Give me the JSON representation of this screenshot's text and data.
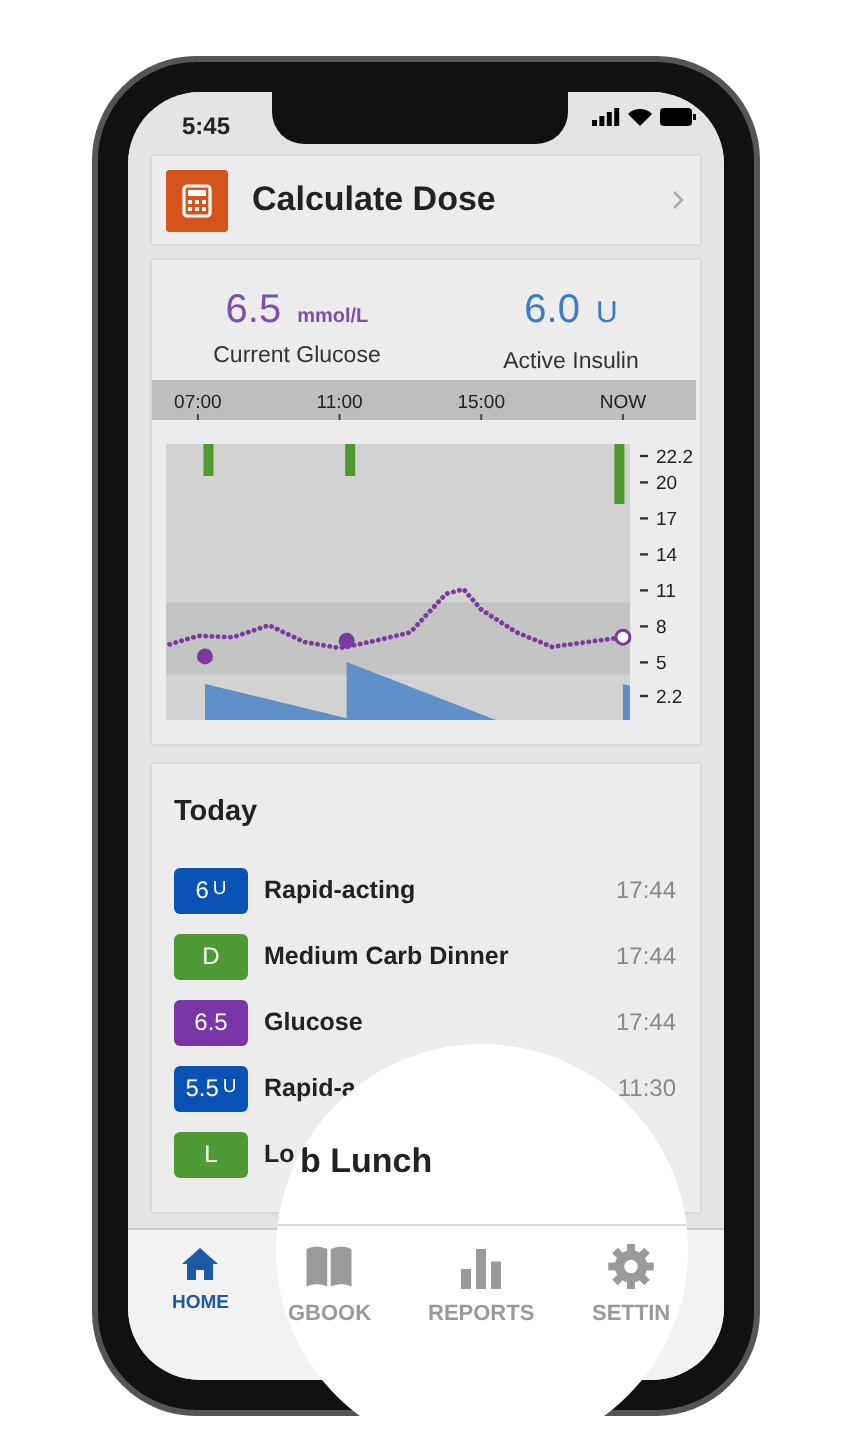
{
  "status_bar": {
    "time": "5:45"
  },
  "dose_card": {
    "title": "Calculate Dose"
  },
  "stats": [
    {
      "value": "6.5",
      "unit": "mmol/L",
      "label": "Current Glucose",
      "color": "#7d4fab"
    },
    {
      "value": "6.0",
      "unit": "U",
      "label": "Active Insulin",
      "color": "#3d7cc4"
    }
  ],
  "chart": {
    "chart_data": {
      "type": "line",
      "xlim": [
        6.1,
        19.2
      ],
      "ylim": [
        0.2,
        23.2
      ],
      "xticks": [
        {
          "value": 7,
          "label": "07:00"
        },
        {
          "value": 11,
          "label": "11:00"
        },
        {
          "value": 15,
          "label": "15:00"
        },
        {
          "value": 19,
          "label": "NOW"
        }
      ],
      "yticks": [
        22.2,
        20,
        17,
        14,
        11,
        8,
        5,
        2.2
      ],
      "x": [
        6.2,
        7,
        7.2,
        8,
        9,
        10,
        11,
        11.2,
        12,
        13,
        14,
        14.5,
        15,
        16,
        17,
        18,
        19
      ],
      "bands": [
        {
          "axis": "y",
          "from": 4,
          "to": 10,
          "color": "#c4c4c4"
        }
      ],
      "series": [
        {
          "color": "#7b3aa0",
          "line_style": "dotted",
          "values": [
            6.5,
            7.2,
            7.2,
            7.1,
            8.1,
            6.7,
            6.2,
            6.3,
            6.8,
            7.5,
            10.7,
            11.1,
            9.4,
            7.5,
            6.3,
            6.7,
            7.1
          ]
        },
        {
          "type": "scatter",
          "color": "#7b3aa0",
          "values": [
            null,
            null,
            5.5,
            null,
            null,
            null,
            null,
            6.8,
            null,
            null,
            null,
            null,
            null,
            null,
            null,
            null,
            null
          ]
        }
      ]
    }
  },
  "today": {
    "title": "Today",
    "entries": [
      {
        "badge": "6",
        "unit": "U",
        "color": "#0a52b5",
        "label": "Rapid-acting",
        "time": "17:44"
      },
      {
        "badge": "D",
        "color": "#4f9a34",
        "label": "Medium Carb Dinner",
        "time": "17:44"
      },
      {
        "badge": "6.5",
        "color": "#7a35a6",
        "label": "Glucose",
        "time": "17:44"
      },
      {
        "badge": "5.5",
        "unit": "U",
        "color": "#0a52b5",
        "label": "Rapid-a",
        "time": "11:30"
      },
      {
        "badge": "L",
        "color": "#4f9a34",
        "label": "Lo"
      }
    ]
  },
  "nav": [
    {
      "kind": "home",
      "label": "HOME",
      "selected": true
    }
  ],
  "magnifier": {
    "text": "b Lunch",
    "nav": [
      {
        "kind": "book",
        "label": "GBOOK",
        "selected": false
      },
      {
        "kind": "chart",
        "label": "REPORTS",
        "selected": false
      },
      {
        "kind": "gear",
        "label": "SETTIN",
        "selected": false
      }
    ]
  }
}
